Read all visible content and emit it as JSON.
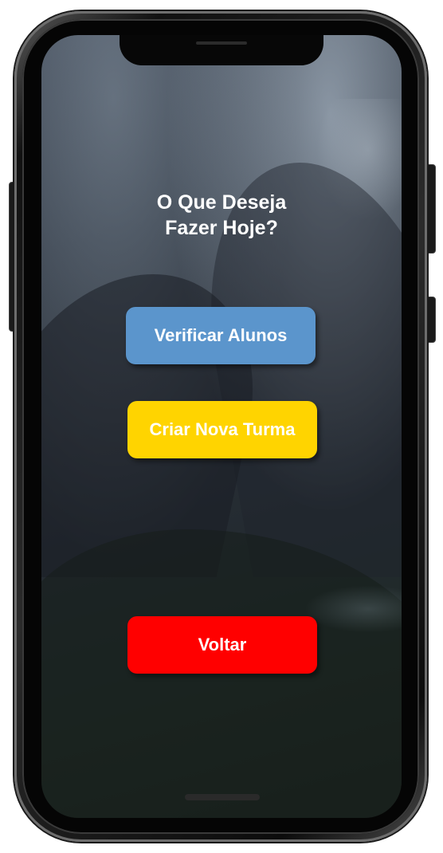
{
  "screen": {
    "title_line1": "O Que Deseja",
    "title_line2": "Fazer Hoje?"
  },
  "buttons": {
    "verificar_label": "Verificar Alunos",
    "criar_label": "Criar Nova Turma",
    "voltar_label": "Voltar"
  },
  "colors": {
    "verificar": "#5b95cc",
    "criar": "#ffd400",
    "voltar": "#ff0000",
    "text": "#ffffff"
  }
}
